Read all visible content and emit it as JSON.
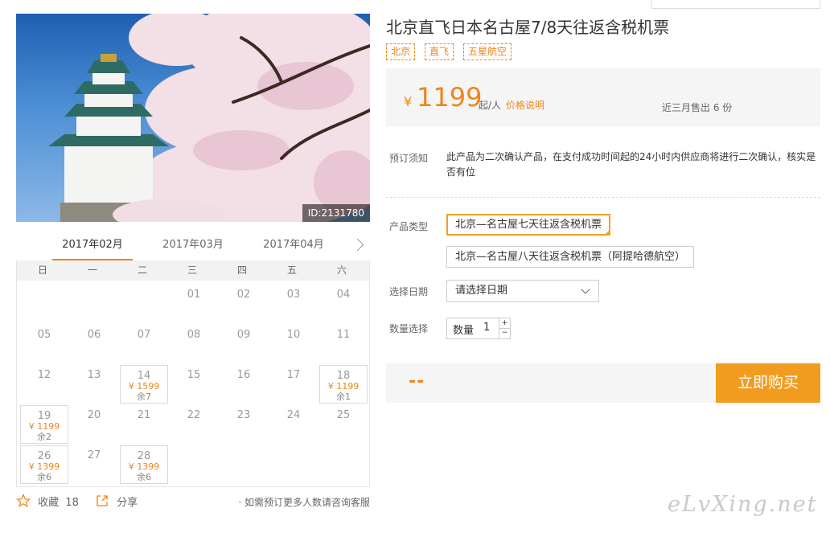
{
  "product": {
    "title": "北京直飞日本名古屋7/8天往返含税机票",
    "tags": [
      "北京",
      "直飞",
      "五星航空"
    ],
    "image_id": "ID:2131780"
  },
  "price": {
    "currency": "¥",
    "amount": "1199",
    "unit": "起/人",
    "note_link": "价格说明",
    "sold": "近三月售出 6 份"
  },
  "booking": {
    "notice_label": "预订须知",
    "notice_text": "此产品为二次确认产品，在支付成功时间起的24小时内供应商将进行二次确认，核实是否有位",
    "type_label": "产品类型",
    "options": [
      "北京—名古屋七天往返含税机票",
      "北京—名古屋八天往返含税机票（阿提哈德航空）"
    ],
    "selected_option": 0,
    "date_label": "选择日期",
    "date_placeholder": "请选择日期",
    "qty_section_label": "数量选择",
    "qty_label": "数量",
    "qty_value": "1",
    "plus": "+",
    "minus": "−",
    "total": "--",
    "buy_label": "立即购买"
  },
  "calendar": {
    "months": [
      "2017年02月",
      "2017年03月",
      "2017年04月"
    ],
    "active_month": 0,
    "weekdays": [
      "日",
      "一",
      "二",
      "三",
      "四",
      "五",
      "六"
    ],
    "first_weekday": 3,
    "days_in_month": 28,
    "available": {
      "14": {
        "price": "¥ 1599",
        "stock": "余7"
      },
      "18": {
        "price": "¥ 1199",
        "stock": "余1"
      },
      "19": {
        "price": "¥ 1199",
        "stock": "余2"
      },
      "26": {
        "price": "¥ 1399",
        "stock": "余6"
      },
      "28": {
        "price": "¥ 1399",
        "stock": "余6"
      }
    }
  },
  "footer": {
    "favorite_label": "收藏",
    "favorite_count": "18",
    "share_label": "分享",
    "contact_note": "· 如需预订更多人数请咨询客服"
  },
  "watermark": "eLvXing.net",
  "colors": {
    "accent": "#f08519",
    "buy_button": "#f29c1f",
    "panel_bg": "#f5f5f5"
  }
}
